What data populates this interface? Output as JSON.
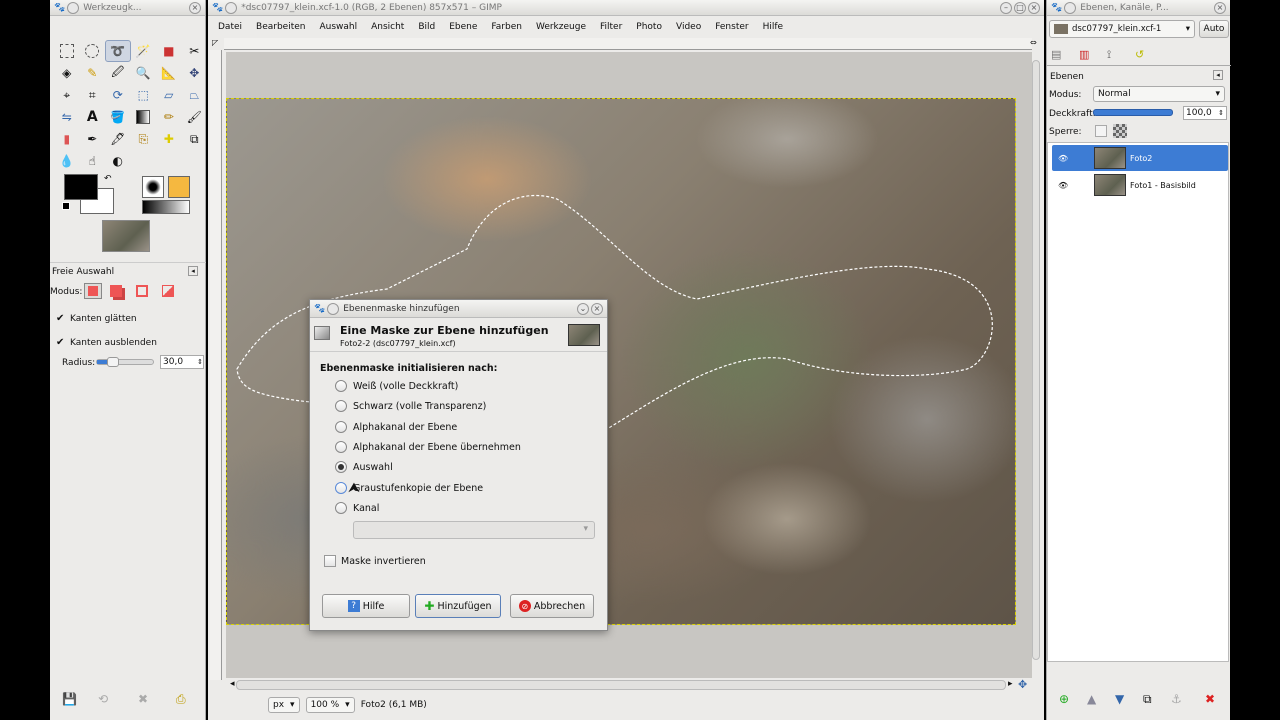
{
  "toolbox": {
    "title": "Werkzeugk...",
    "tool_options_title": "Freie Auswahl",
    "mode_label": "Modus:",
    "antialias_label": "Kanten glätten",
    "feather_label": "Kanten ausblenden",
    "radius_label": "Radius:",
    "radius_value": "30,0"
  },
  "image_window": {
    "title": "*dsc07797_klein.xcf-1.0 (RGB, 2 Ebenen) 857x571 – GIMP",
    "menu": [
      "Datei",
      "Bearbeiten",
      "Auswahl",
      "Ansicht",
      "Bild",
      "Ebene",
      "Farben",
      "Werkzeuge",
      "Filter",
      "Photo",
      "Video",
      "Fenster",
      "Hilfe"
    ],
    "status": {
      "unit": "px",
      "zoom": "100 %",
      "info": "Foto2 (6,1 MB)"
    }
  },
  "dock": {
    "title": "Ebenen, Kanäle, P...",
    "image_select": "dsc07797_klein.xcf-1",
    "auto_label": "Auto",
    "panel_title": "Ebenen",
    "mode_label": "Modus:",
    "mode_value": "Normal",
    "opacity_label": "Deckkraft:",
    "opacity_value": "100,0",
    "lock_label": "Sperre:",
    "layers": [
      {
        "name": "Foto2",
        "selected": true
      },
      {
        "name": "Foto1 - Basisbild",
        "selected": false
      }
    ]
  },
  "dialog": {
    "title": "Ebenenmaske hinzufügen",
    "heading": "Eine Maske zur Ebene hinzufügen",
    "subheading": "Foto2-2 (dsc07797_klein.xcf)",
    "section_label": "Ebenenmaske initialisieren nach:",
    "options": [
      {
        "label": "Weiß (volle Deckkraft)",
        "checked": false
      },
      {
        "label": "Schwarz (volle Transparenz)",
        "checked": false
      },
      {
        "label": "Alphakanal der Ebene",
        "checked": false
      },
      {
        "label": "Alphakanal der Ebene übernehmen",
        "checked": false
      },
      {
        "label": "Auswahl",
        "checked": true
      },
      {
        "label": "Graustufenkopie der Ebene",
        "checked": false
      },
      {
        "label": "Kanal",
        "checked": false
      }
    ],
    "invert_label": "Maske invertieren",
    "help_label": "Hilfe",
    "add_label": "Hinzufügen",
    "cancel_label": "Abbrechen"
  },
  "colors": {
    "selection_blue": "#3d7cd4",
    "fg_color": "#000000",
    "bg_color": "#ffffff",
    "gradient_accent": "#f5b840"
  }
}
